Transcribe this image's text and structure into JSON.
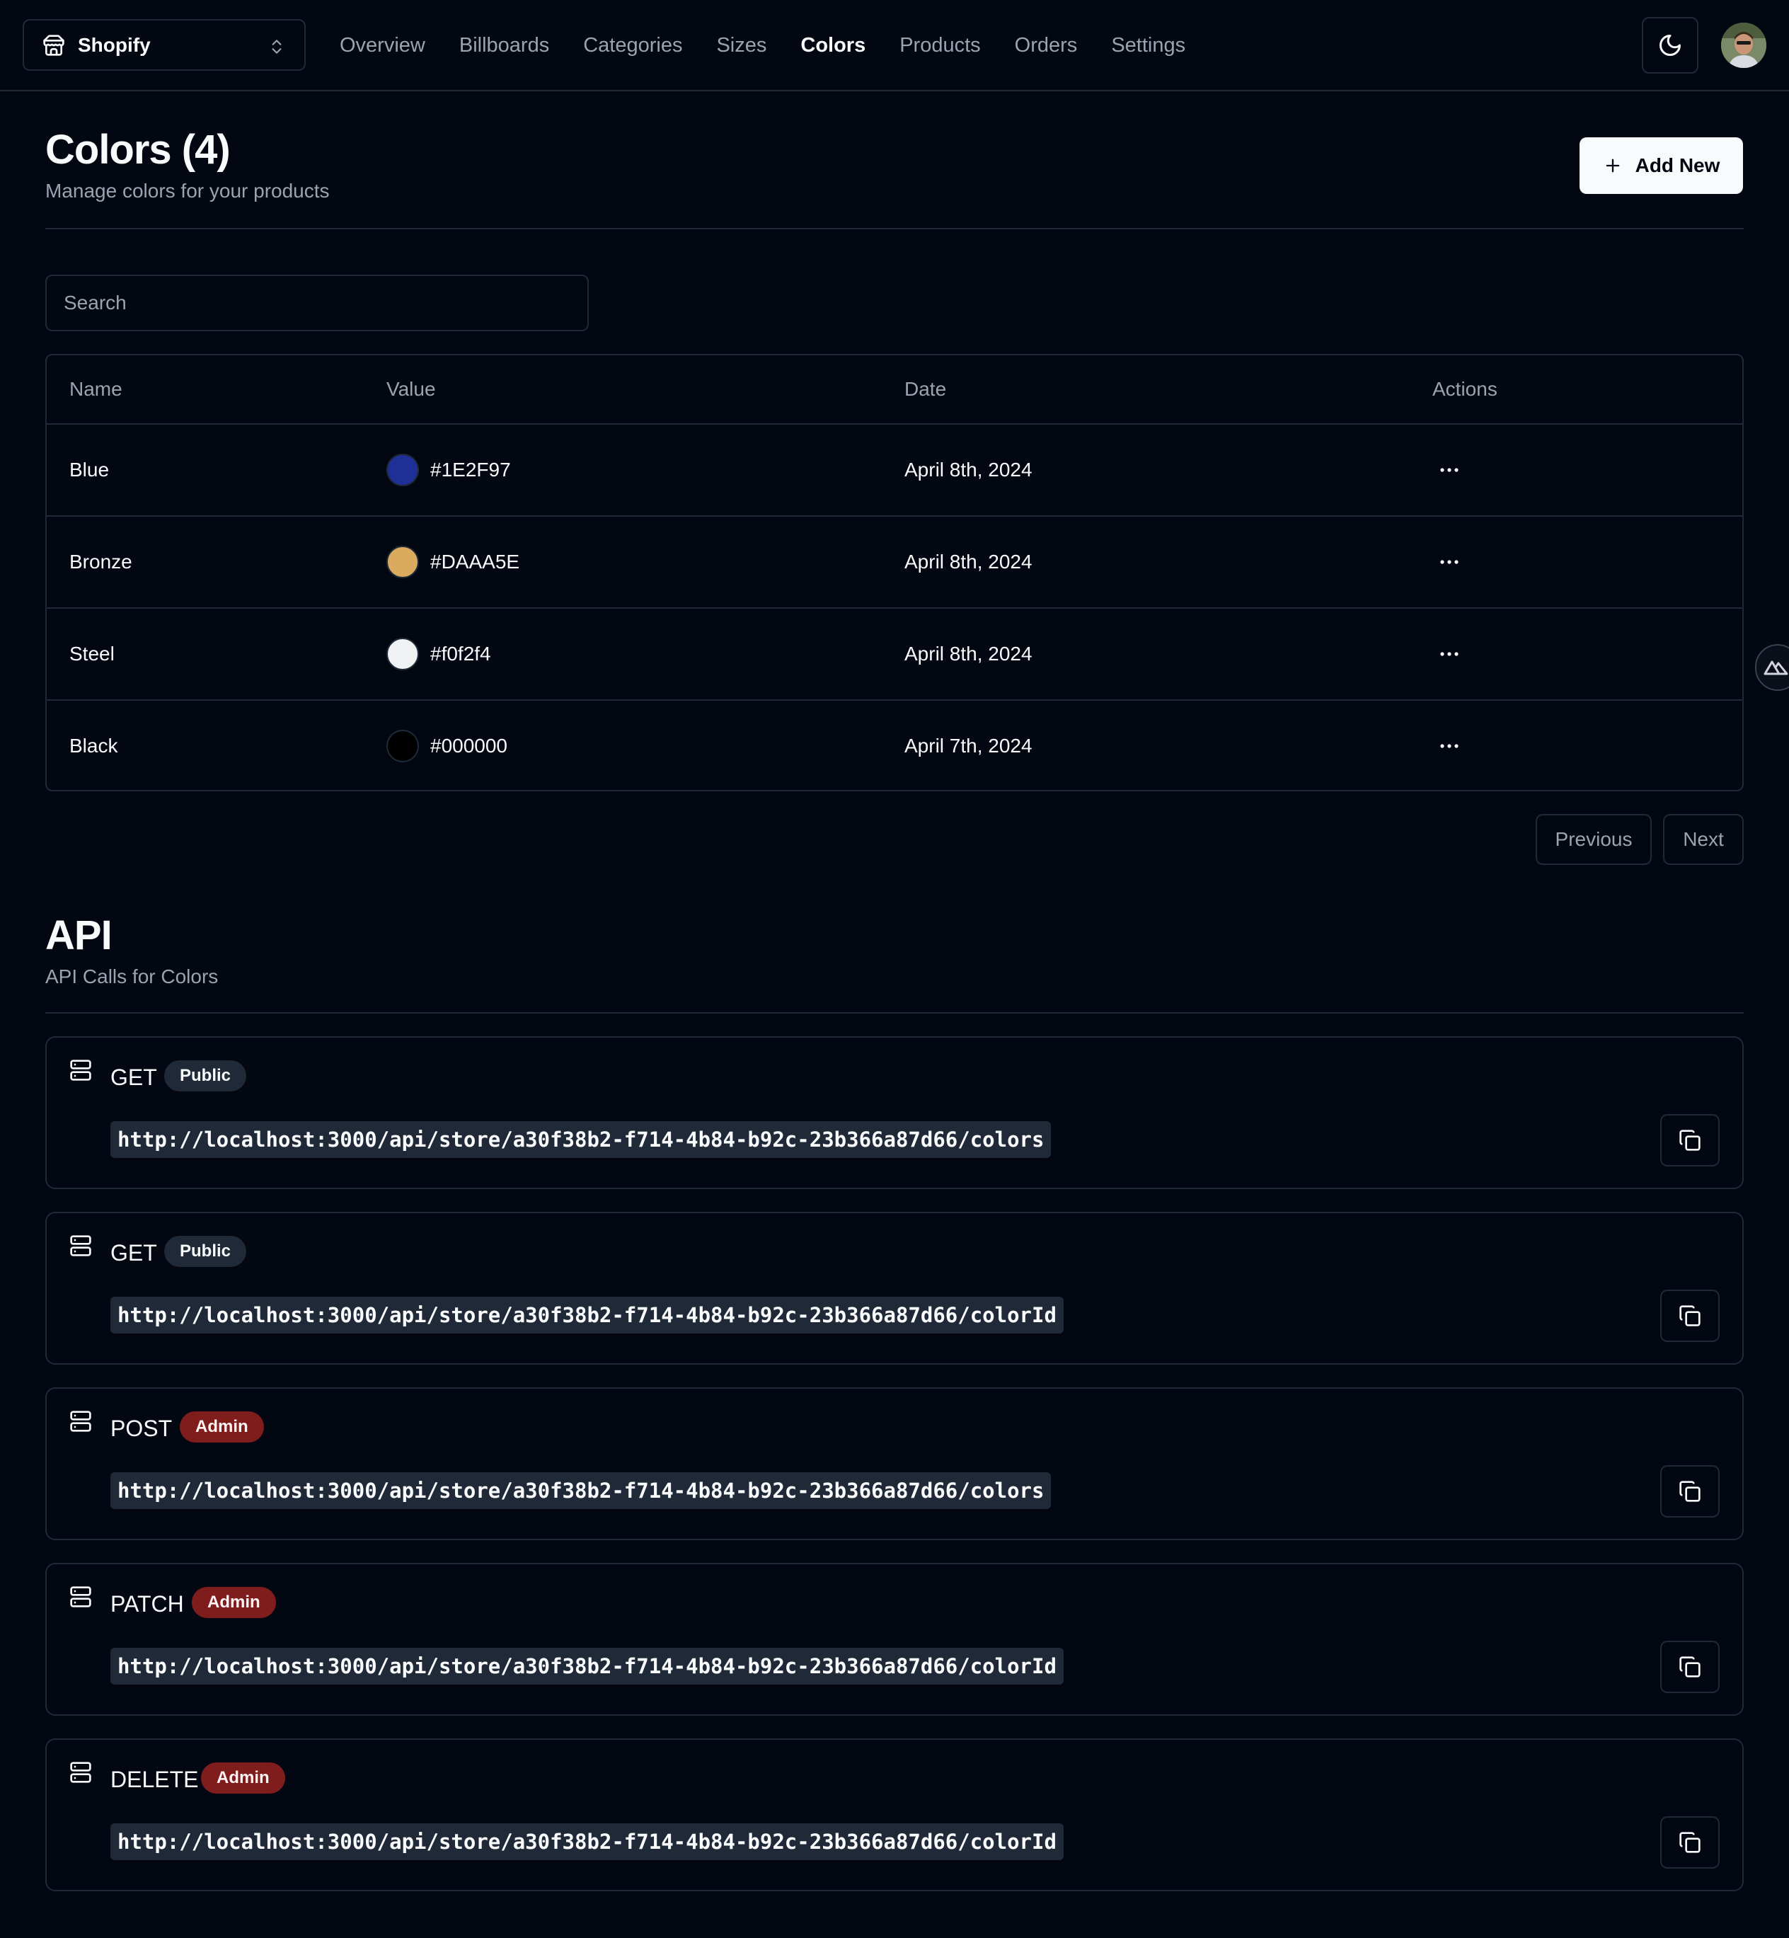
{
  "navbar": {
    "store_name": "Shopify",
    "links": [
      {
        "label": "Overview",
        "active": false
      },
      {
        "label": "Billboards",
        "active": false
      },
      {
        "label": "Categories",
        "active": false
      },
      {
        "label": "Sizes",
        "active": false
      },
      {
        "label": "Colors",
        "active": true
      },
      {
        "label": "Products",
        "active": false
      },
      {
        "label": "Orders",
        "active": false
      },
      {
        "label": "Settings",
        "active": false
      }
    ],
    "theme_icon": "moon-icon",
    "avatar_icon": "user-avatar"
  },
  "header": {
    "title": "Colors (4)",
    "description": "Manage colors for your products",
    "add_button": "Add New"
  },
  "search": {
    "placeholder": "Search",
    "value": ""
  },
  "table": {
    "columns": [
      "Name",
      "Value",
      "Date",
      "Actions"
    ],
    "rows": [
      {
        "name": "Blue",
        "value": "#1E2F97",
        "swatch": "#1E2F97",
        "date": "April 8th, 2024"
      },
      {
        "name": "Bronze",
        "value": "#DAAA5E",
        "swatch": "#DAAA5E",
        "date": "April 8th, 2024"
      },
      {
        "name": "Steel",
        "value": "#f0f2f4",
        "swatch": "#f0f2f4",
        "date": "April 8th, 2024"
      },
      {
        "name": "Black",
        "value": "#000000",
        "swatch": "#000000",
        "date": "April 7th, 2024"
      }
    ]
  },
  "pagination": {
    "previous": "Previous",
    "next": "Next"
  },
  "api": {
    "title": "API",
    "description": "API Calls for Colors",
    "calls": [
      {
        "method": "GET",
        "badge": "Public",
        "variant": "public",
        "url": "http://localhost:3000/api/store/a30f38b2-f714-4b84-b92c-23b366a87d66/colors"
      },
      {
        "method": "GET",
        "badge": "Public",
        "variant": "public",
        "url": "http://localhost:3000/api/store/a30f38b2-f714-4b84-b92c-23b366a87d66/colorId"
      },
      {
        "method": "POST",
        "badge": "Admin",
        "variant": "admin",
        "url": "http://localhost:3000/api/store/a30f38b2-f714-4b84-b92c-23b366a87d66/colors"
      },
      {
        "method": "PATCH",
        "badge": "Admin",
        "variant": "admin",
        "url": "http://localhost:3000/api/store/a30f38b2-f714-4b84-b92c-23b366a87d66/colorId"
      },
      {
        "method": "DELETE",
        "badge": "Admin",
        "variant": "admin",
        "url": "http://localhost:3000/api/store/a30f38b2-f714-4b84-b92c-23b366a87d66/colorId"
      }
    ]
  },
  "colors": {
    "background": "#030712",
    "border": "#1f2937",
    "muted_text": "#9ca3af",
    "admin_badge": "#7f1d1d",
    "public_badge": "#1f2937"
  }
}
